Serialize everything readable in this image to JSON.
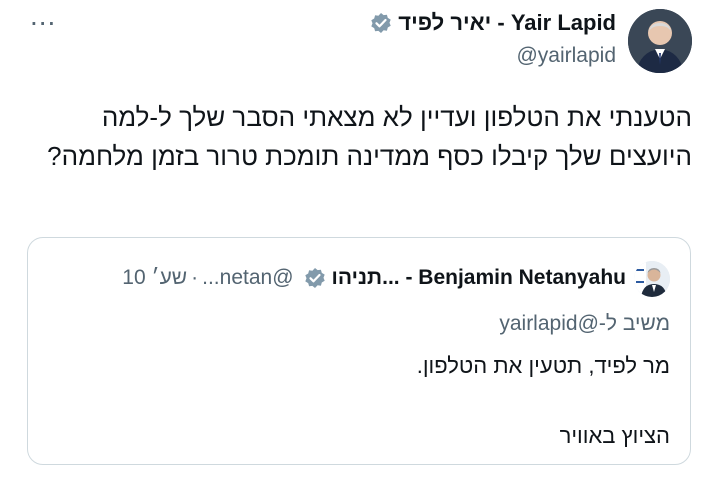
{
  "tweet": {
    "author_display_name": "Yair Lapid - יאיר לפיד",
    "author_handle": "@yairlapid",
    "more_icon": "...",
    "verified_icon": "verified-badge-icon",
    "text": "הטענתי את הטלפון ועדיין לא מצאתי הסבר שלך ל-למה היועצים שלך קיבלו כסף ממדינה תומכת טרור בזמן מלחמה?"
  },
  "quoted_tweet": {
    "author_display_name": "Benjamin Netanyahu - בנימין נתניהו",
    "author_display_name_truncated": "Benjamin Netanyahu - ...תניהו",
    "handle_truncated": "@netan...",
    "separator": "·",
    "time": "שע׳ 10",
    "reply_prefix": "משיב ל-",
    "reply_handle": "@yairlapid",
    "text": "מר לפיד, תטעין את הטלפון.\n\nהציוץ באוויר"
  },
  "colors": {
    "text_primary": "#0f1419",
    "text_secondary": "#536471",
    "border": "#cfd9de",
    "verified_gray": "#829aab"
  }
}
